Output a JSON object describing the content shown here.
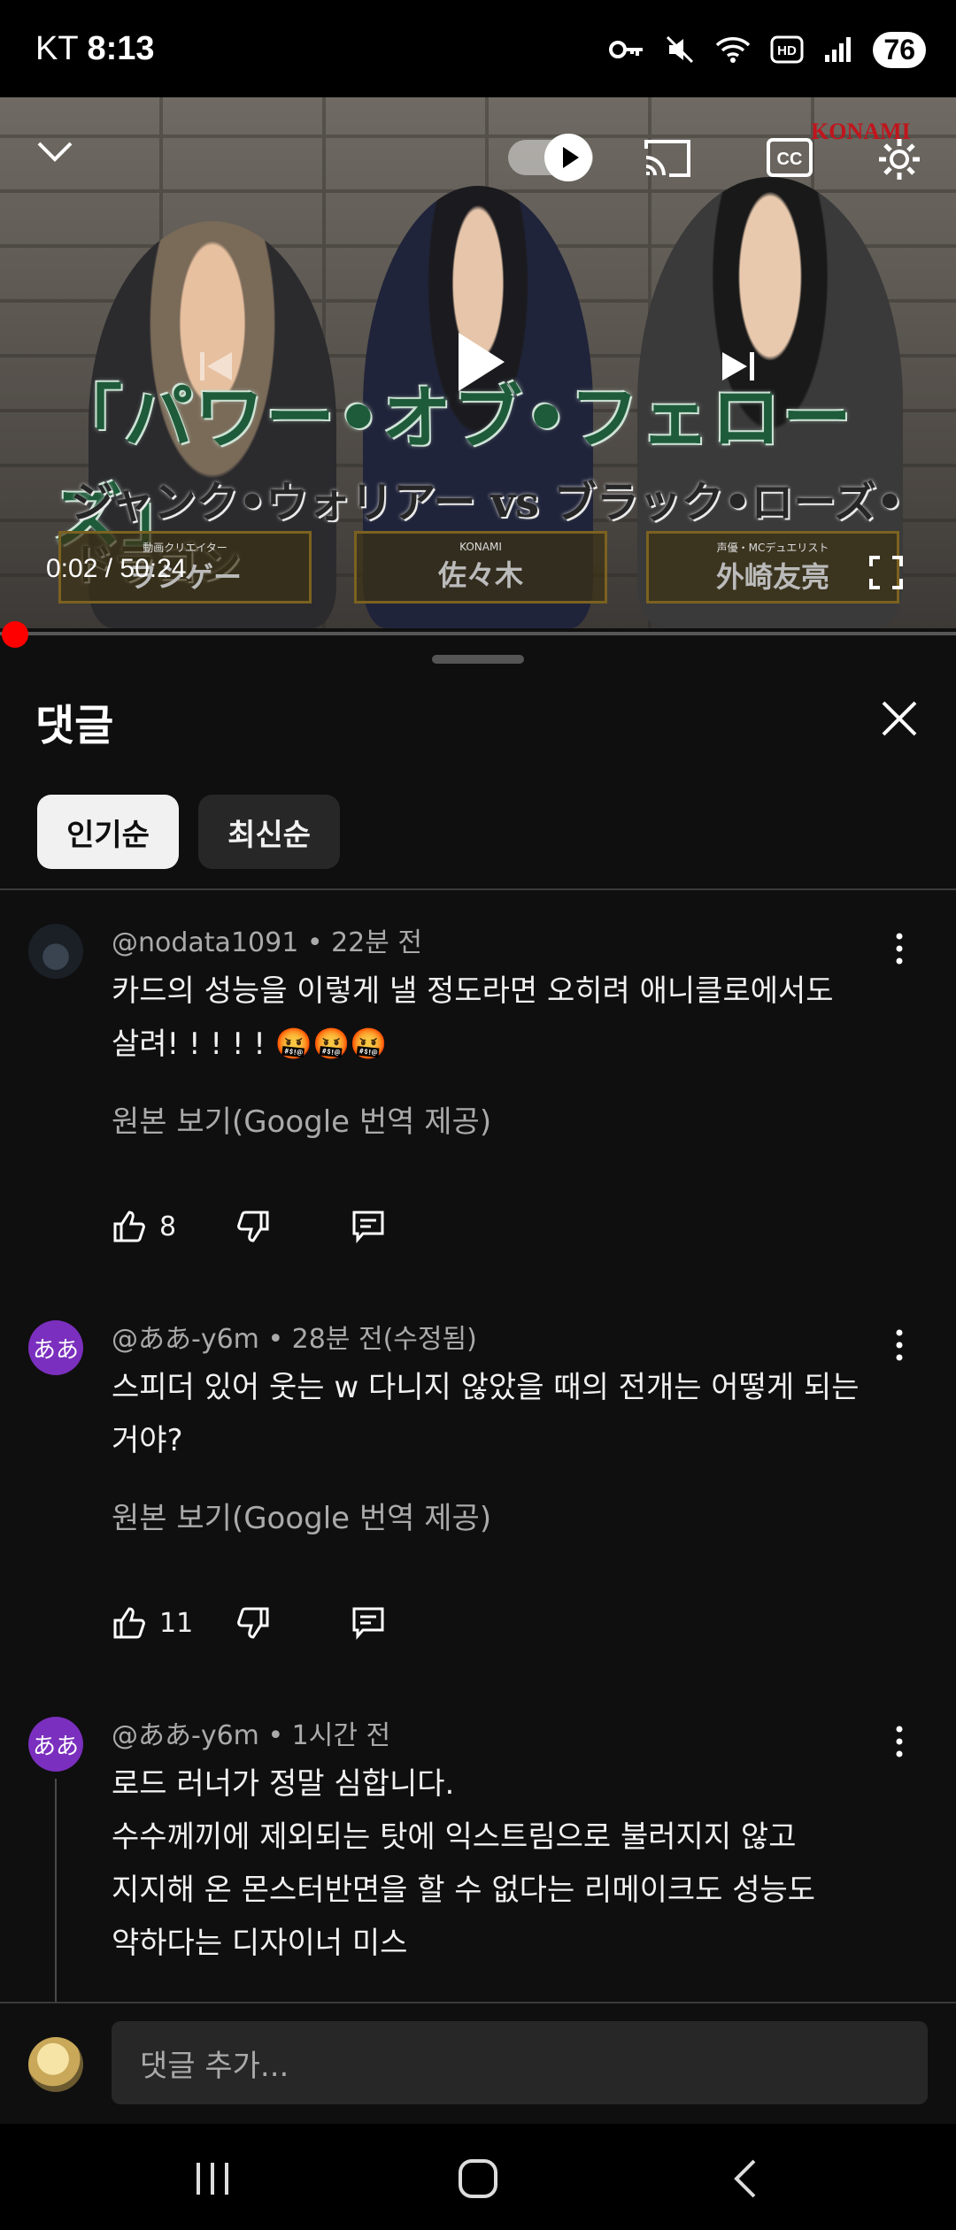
{
  "status_bar": {
    "carrier": "KT",
    "time": "8:13",
    "battery": "76"
  },
  "video": {
    "brand": "KONAMI",
    "title_text": "「パワー•オブ•フェローズ」",
    "subtitle_text": "ジャンク•ウォリアー vs ブラック•ローズ•ドラゴン",
    "nameplates": [
      {
        "small": "動画クリエイター",
        "name": "ヲシゲー"
      },
      {
        "small": "KONAMI",
        "name": "佐々木"
      },
      {
        "small": "声優・MCデュエリスト",
        "name": "外崎友亮"
      }
    ],
    "time": "0:02 / 50:24",
    "progress": 0.0007
  },
  "panel": {
    "title": "댓글",
    "sort_chips": [
      {
        "label": "인기순",
        "selected": true
      },
      {
        "label": "최신순",
        "selected": false
      }
    ]
  },
  "comments": [
    {
      "author": "@nodata1091",
      "time": "• 22분 전",
      "lines": [
        "카드의 성능을 이렇게 낼 정도라면 오히려 애니클로에서도",
        "살려! ! ! ! ! 🤬🤬🤬"
      ],
      "translate": "원본 보기(Google 번역 제공)",
      "likes": "8"
    },
    {
      "author": "@ああ-y6m",
      "time": "• 28분 전(수정됨)",
      "avatar_text": "ああ",
      "lines": [
        "스피더 있어 웃는 w 다니지 않았을 때의 전개는 어떻게 되는",
        "거야?"
      ],
      "translate": "원본 보기(Google 번역 제공)",
      "likes": "11"
    },
    {
      "author": "@ああ-y6m",
      "time": "• 1시간 전",
      "avatar_text": "ああ",
      "lines": [
        "로드 러너가 정말 심합니다.",
        "수수께끼에 제외되는 탓에 익스트림으로 불러지지 않고",
        "지지해 온 몬스터반면을 할 수 없다는 리메이크도 성능도",
        "약하다는 디자이너 미스"
      ]
    }
  ],
  "add_comment": {
    "placeholder": "댓글 추가..."
  },
  "colors": {
    "accent_red": "#ff0000",
    "avatar_purple": "#7b2fbe",
    "background": "#0f0f0f"
  }
}
